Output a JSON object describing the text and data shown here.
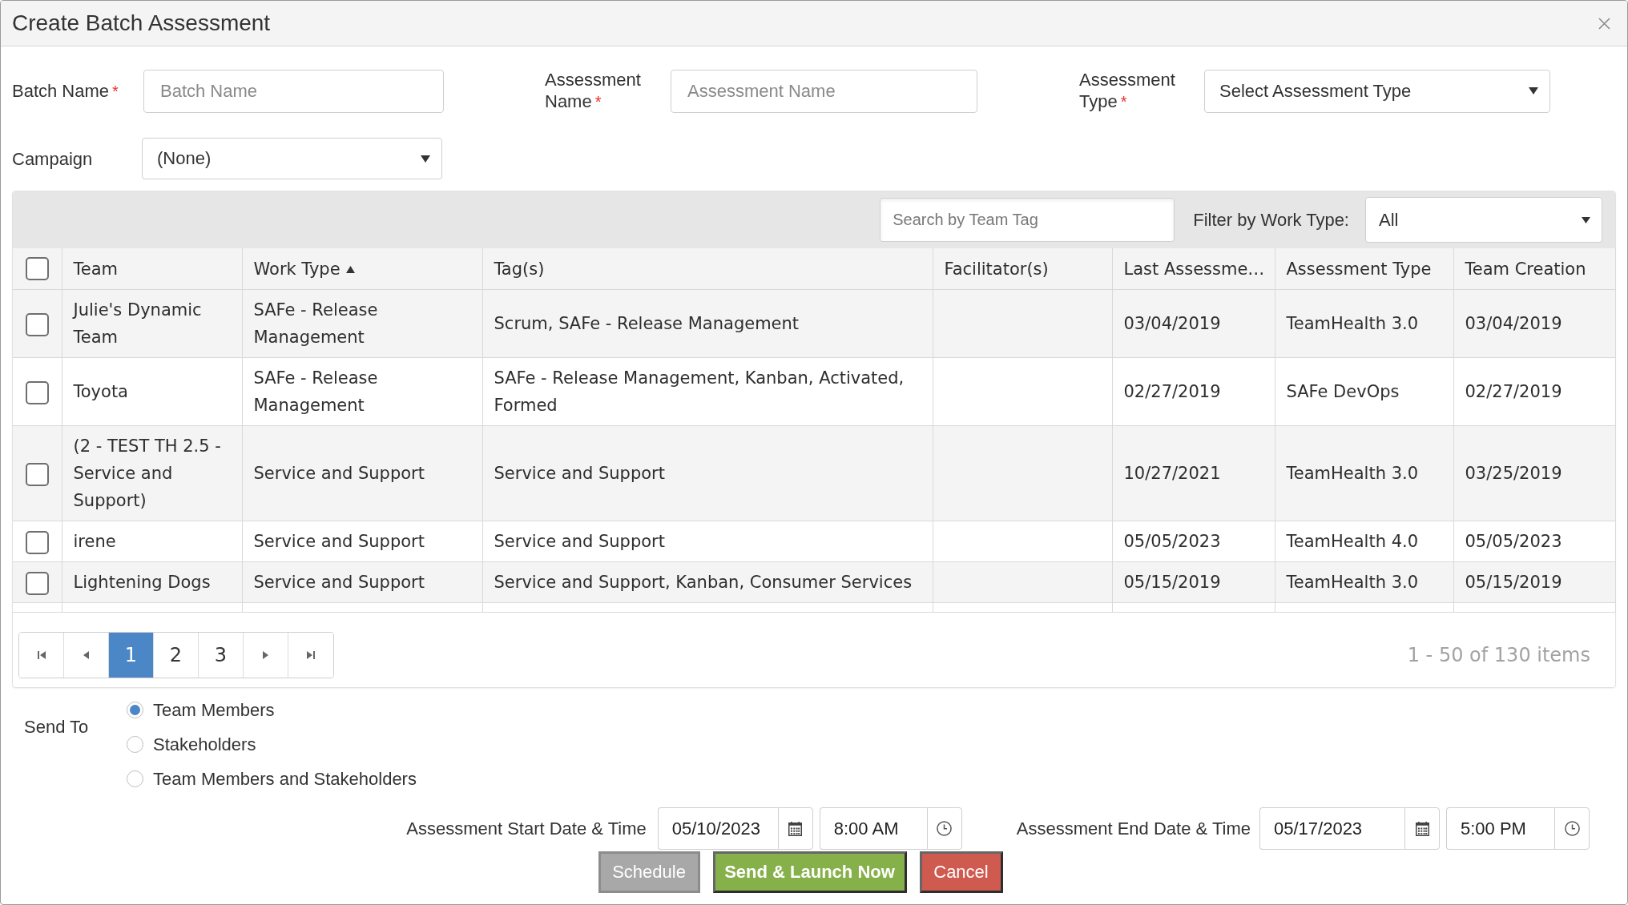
{
  "dialog": {
    "title": "Create Batch Assessment"
  },
  "form": {
    "rows": [
      {
        "fields": [
          {
            "kind": "input",
            "label": "Batch Name",
            "required_mark": "*",
            "placeholder": "Batch Name"
          },
          {
            "kind": "input",
            "label": "Assessment Name",
            "required_mark": "*",
            "placeholder": "Assessment Name"
          },
          {
            "kind": "select",
            "label": "Assessment Type",
            "required_mark": "*",
            "value": "Select Assessment Type"
          }
        ]
      },
      {
        "fields": [
          {
            "kind": "select",
            "label": "Campaign",
            "value": "(None)"
          }
        ]
      }
    ]
  },
  "grid": {
    "search": {
      "placeholder": "Search by Team Tag"
    },
    "filter": {
      "label": "Filter by Work Type:",
      "value": "All"
    },
    "select_all": {
      "checked": false
    },
    "columns": [
      {
        "label": "Team",
        "sort_ascending": false
      },
      {
        "label": "Work Type",
        "sort_ascending": true
      },
      {
        "label": "Tag(s)",
        "sort_ascending": false
      },
      {
        "label": "Facilitator(s)",
        "sort_ascending": false
      },
      {
        "label": "Last Assessme…",
        "sort_ascending": false
      },
      {
        "label": "Assessment Type",
        "sort_ascending": false
      },
      {
        "label": "Team Creation",
        "sort_ascending": false
      }
    ],
    "rows": [
      {
        "checked": false,
        "team": "Julie's Dynamic Team",
        "work_type": "SAFe - Release Management",
        "tags": "Scrum, SAFe - Release Management",
        "last_assessment": "03/04/2019",
        "assessment_type": "TeamHealth 3.0",
        "team_creation": "03/04/2019"
      },
      {
        "checked": false,
        "team": "Toyota",
        "work_type": "SAFe - Release Management",
        "tags": "SAFe - Release Management, Kanban, Activated, Formed",
        "last_assessment": "02/27/2019",
        "assessment_type": "SAFe DevOps",
        "team_creation": "02/27/2019"
      },
      {
        "checked": false,
        "team": "(2 - TEST TH 2.5 - Service and Support)",
        "work_type": "Service and Support",
        "tags": "Service and Support",
        "last_assessment": "10/27/2021",
        "assessment_type": "TeamHealth 3.0",
        "team_creation": "03/25/2019"
      },
      {
        "checked": false,
        "team": "irene",
        "work_type": "Service and Support",
        "tags": "Service and Support",
        "last_assessment": "05/05/2023",
        "assessment_type": "TeamHealth 4.0",
        "team_creation": "05/05/2023"
      },
      {
        "checked": false,
        "team": "Lightening Dogs",
        "work_type": "Service and Support",
        "tags": "Service and Support, Kanban, Consumer Services",
        "last_assessment": "05/15/2019",
        "assessment_type": "TeamHealth 3.0",
        "team_creation": "05/15/2019"
      }
    ],
    "pager": {
      "pages": [
        {
          "label": "1",
          "selected": true
        },
        {
          "label": "2",
          "selected": false
        },
        {
          "label": "3",
          "selected": false
        }
      ],
      "summary": "1 - 50 of 130 items"
    }
  },
  "send_to": {
    "label": "Send To",
    "options": [
      {
        "label": "Team Members",
        "selected": true
      },
      {
        "label": "Stakeholders",
        "selected": false
      },
      {
        "label": "Team Members and Stakeholders",
        "selected": false
      }
    ]
  },
  "schedule": [
    {
      "label": "Assessment Start Date & Time",
      "date": "05/10/2023",
      "time": "8:00 AM"
    },
    {
      "label": "Assessment End Date & Time",
      "date": "05/17/2023",
      "time": "5:00 PM"
    }
  ],
  "buttons": [
    {
      "label": "Schedule",
      "kind": "secondary"
    },
    {
      "label": "Send & Launch Now",
      "kind": "primary"
    },
    {
      "label": "Cancel",
      "kind": "danger"
    }
  ]
}
